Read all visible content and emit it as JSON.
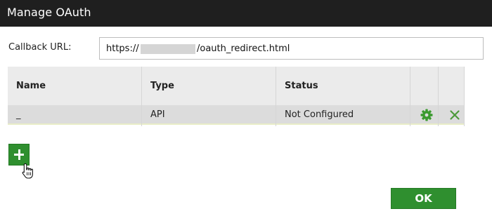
{
  "dialog": {
    "title": "Manage OAuth"
  },
  "callback": {
    "label": "Callback URL:",
    "value_prefix": "https://",
    "value_suffix": "/oauth_redirect.html"
  },
  "table": {
    "columns": [
      "Name",
      "Type",
      "Status"
    ],
    "rows": [
      {
        "name": "_",
        "type": "API",
        "status": "Not Configured"
      }
    ]
  },
  "icons": {
    "configure": "gear-icon",
    "delete": "close-icon",
    "add": "plus-icon",
    "cursor": "hand-pointer-icon"
  },
  "colors": {
    "titlebar": "#1f1f1f",
    "accent_green": "#2f8f2f",
    "header_bg": "#ebebeb",
    "row_bg": "#dcdcdc"
  },
  "footer": {
    "ok_label": "OK"
  }
}
